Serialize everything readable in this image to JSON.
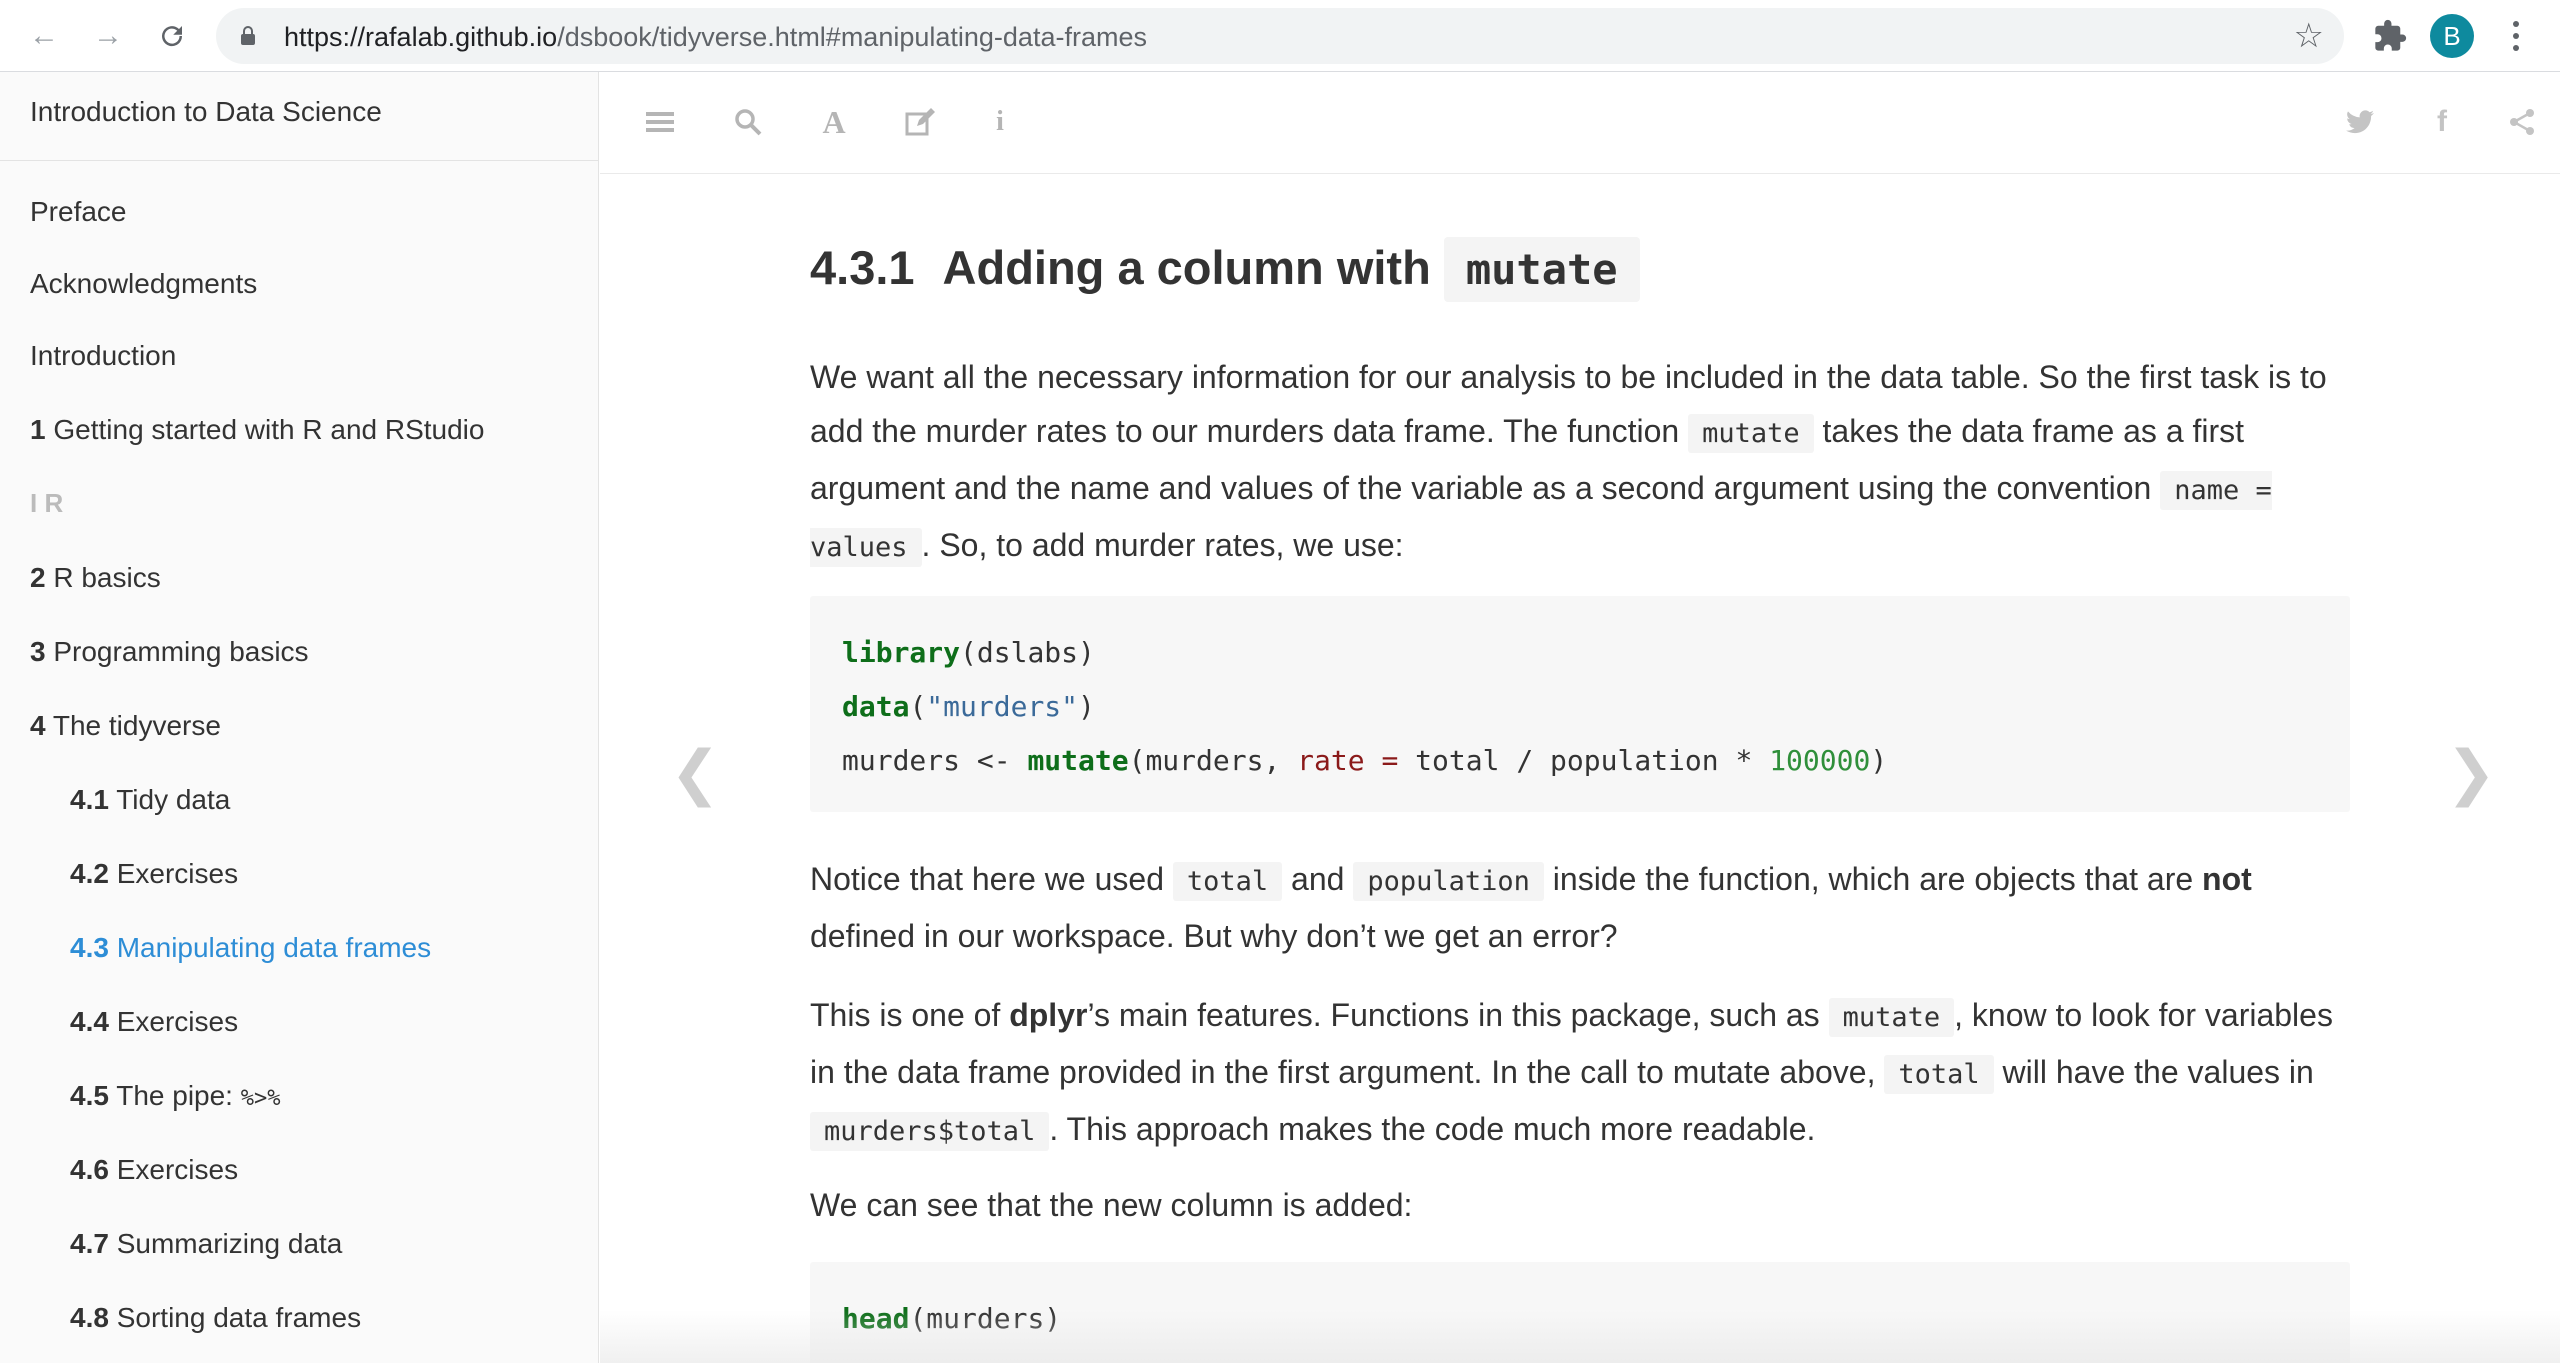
{
  "browser": {
    "url_host": "https://rafalab.github.io",
    "url_path": "/dsbook/tidyverse.html#manipulating-data-frames",
    "avatar_letter": "B"
  },
  "sidebar": {
    "book_title": "Introduction to Data Science",
    "items": [
      {
        "num": "",
        "label": "Preface"
      },
      {
        "num": "",
        "label": "Acknowledgments"
      },
      {
        "num": "",
        "label": "Introduction"
      },
      {
        "num": "1",
        "label": "Getting started with R and RStudio"
      },
      {
        "num": "",
        "label": "I R"
      },
      {
        "num": "2",
        "label": "R basics"
      },
      {
        "num": "3",
        "label": "Programming basics"
      },
      {
        "num": "4",
        "label": "The tidyverse"
      },
      {
        "num": "4.1",
        "label": "Tidy data"
      },
      {
        "num": "4.2",
        "label": "Exercises"
      },
      {
        "num": "4.3",
        "label": "Manipulating data frames"
      },
      {
        "num": "4.4",
        "label": "Exercises"
      },
      {
        "num": "4.5",
        "label": "The pipe: ",
        "code": "%>%"
      },
      {
        "num": "4.6",
        "label": "Exercises"
      },
      {
        "num": "4.7",
        "label": "Summarizing data"
      },
      {
        "num": "4.8",
        "label": "Sorting data frames"
      }
    ]
  },
  "content": {
    "heading_num": "4.3.1",
    "heading_text": "Adding a column with ",
    "heading_code": "mutate",
    "p1": {
      "t1": "We want all the necessary information for our analysis to be included in the data table. So the first task is to add the murder rates to our murders data frame. The function ",
      "c1": "mutate",
      "t2": " takes the data frame as a first argument and the name and values of the variable as a second argument using the convention ",
      "c2": "name = values",
      "t3": ". So, to add murder rates, we use:"
    },
    "code1": {
      "l1_fn": "library",
      "l1_rest": "(dslabs)",
      "l2_fn": "data",
      "l2_open": "(",
      "l2_str": "\"murders\"",
      "l2_close": ")",
      "l3_a": "murders <- ",
      "l3_fn": "mutate",
      "l3_b": "(murders, ",
      "l3_arg": "rate =",
      "l3_c": " total / population * ",
      "l3_num": "100000",
      "l3_d": ")"
    },
    "p2": {
      "t1": "Notice that here we used ",
      "c1": "total",
      "t2": " and ",
      "c2": "population",
      "t3": " inside the function, which are objects that are ",
      "b1": "not",
      "t4": " defined in our workspace. But why don’t we get an error?"
    },
    "p3": {
      "t1": "This is one of ",
      "b1": "dplyr",
      "t2": "’s main features. Functions in this package, such as ",
      "c1": "mutate",
      "t3": ", know to look for variables in the data frame provided in the first argument. In the call to mutate above, ",
      "c2": "total",
      "t4": " will have the values in ",
      "c3": "murders$total",
      "t5": ". This approach makes the code much more readable."
    },
    "p4": "We can see that the new column is added:",
    "code2": {
      "fn": "head",
      "rest": "(murders)"
    }
  }
}
